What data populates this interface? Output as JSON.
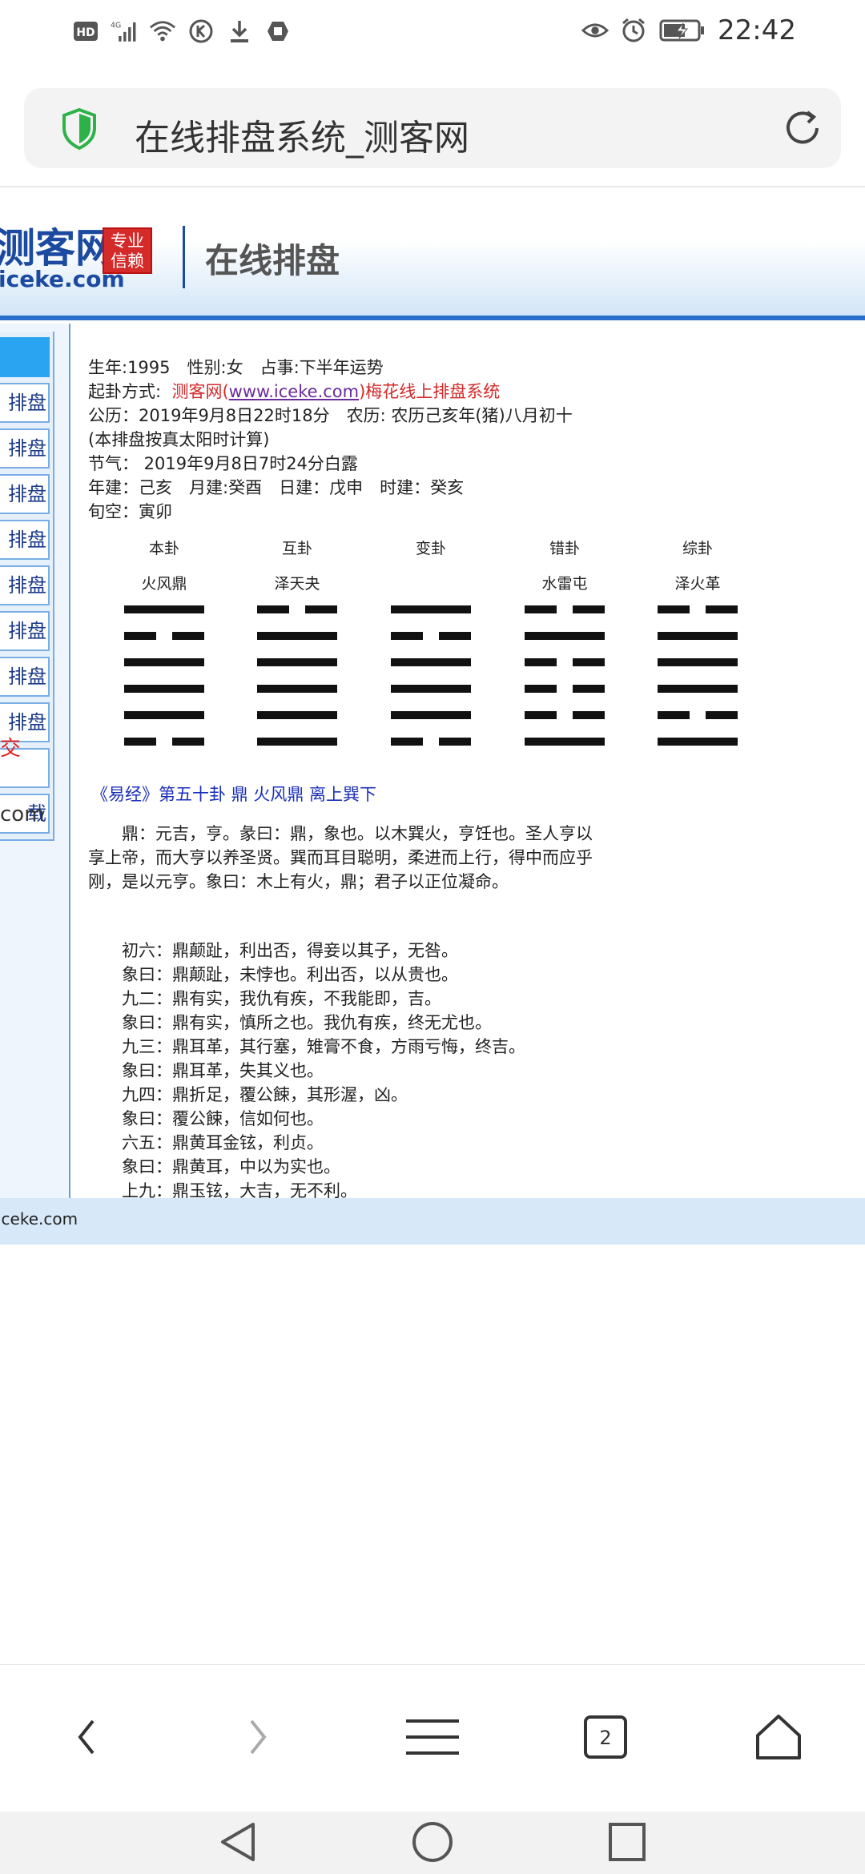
{
  "status_bar": {
    "left_icons": [
      "hd-icon",
      "signal-4g-icon",
      "wifi-icon",
      "k-icon",
      "download-icon",
      "shield-app-icon"
    ],
    "hd_label": "HD",
    "signal_label": "4G",
    "time": "22:42"
  },
  "browser": {
    "page_title": "在线排盘系统_测客网",
    "tab_count": "2"
  },
  "site": {
    "logo_cn": "测客网",
    "logo_en": "iceke.com",
    "badge": "专业信赖",
    "header_title": "在线排盘",
    "footer_text": "iceke.com"
  },
  "sidebar": {
    "items": [
      {
        "label": ""
      },
      {
        "label": "排盘"
      },
      {
        "label": "排盘"
      },
      {
        "label": "排盘"
      },
      {
        "label": "排盘"
      },
      {
        "label": "排盘"
      },
      {
        "label": "排盘"
      },
      {
        "label": "排盘"
      },
      {
        "label": "排盘"
      },
      {
        "label": ""
      },
      {
        "label": "载"
      }
    ],
    "red_text": "交",
    "com_text": "com"
  },
  "info": {
    "line1": "生年:1995　性别:女　占事:下半年运势",
    "qigua_label": "起卦方式:",
    "qigua_pre": "测客网(",
    "qigua_link": "www.iceke.com",
    "qigua_post": ")梅花线上排盘系统",
    "line3": "公历：2019年9月8日22时18分　农历: 农历己亥年(猪)八月初十",
    "line4": "(本排盘按真太阳时计算)",
    "line5": "节气：  2019年9月8日7时24分白露",
    "line6": "年建：己亥　月建:癸酉　日建：戊申　时建：癸亥",
    "line7": "旬空：寅卯"
  },
  "gua": [
    {
      "head": "本卦",
      "name": "火风鼎",
      "lines": [
        "yang",
        "yin",
        "yang",
        "yang",
        "yang",
        "yin"
      ]
    },
    {
      "head": "互卦",
      "name": "泽天夬",
      "lines": [
        "yin",
        "yang",
        "yang",
        "yang",
        "yang",
        "yang"
      ]
    },
    {
      "head": "变卦",
      "name": "",
      "lines": [
        "yang",
        "yin",
        "yang",
        "yang",
        "yang",
        "yin"
      ]
    },
    {
      "head": "错卦",
      "name": "水雷屯",
      "lines": [
        "yin",
        "yang",
        "yin",
        "yin",
        "yin",
        "yang"
      ]
    },
    {
      "head": "综卦",
      "name": "泽火革",
      "lines": [
        "yin",
        "yang",
        "yang",
        "yang",
        "yin",
        "yang"
      ]
    }
  ],
  "yijing": {
    "title": "《易经》第五十卦 鼎 火风鼎 离上巽下",
    "paragraph": "鼎：元吉，亨。彖曰：鼎，象也。以木巽火，亨饪也。圣人亨以享上帝，而大亨以养圣贤。巽而耳目聪明，柔进而上行，得中而应乎刚，是以元亨。象曰：木上有火，鼎；君子以正位凝命。",
    "yao_lines": [
      "初六：鼎颠趾，利出否，得妾以其子，无咎。",
      "象曰：鼎颠趾，未悖也。利出否，以从贵也。",
      "九二：鼎有实，我仇有疾，不我能即，吉。",
      "象曰：鼎有实，慎所之也。我仇有疾，终无尤也。",
      "九三：鼎耳革，其行塞，雉膏不食，方雨亏悔，终吉。",
      "象曰：鼎耳革，失其义也。",
      "九四：鼎折足，覆公餗，其形渥，凶。",
      "象曰：覆公餗，信如何也。",
      "六五：鼎黄耳金铉，利贞。",
      "象曰：鼎黄耳，中以为实也。",
      "上九：鼎玉铉，大吉，无不利。"
    ]
  }
}
